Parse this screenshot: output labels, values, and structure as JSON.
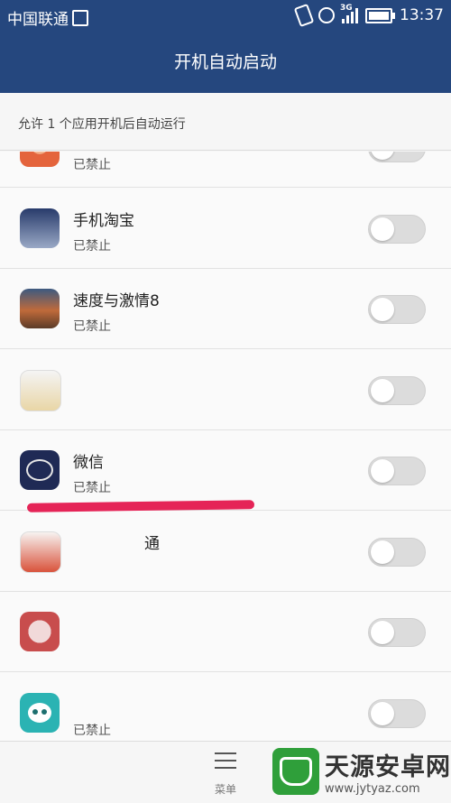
{
  "status_bar": {
    "carrier": "中国联通",
    "network": "3G",
    "time": "13:37"
  },
  "header": {
    "title": "开机自动启动"
  },
  "summary": "允许 1 个应用开机后自动运行",
  "apps": [
    {
      "name": "",
      "status": "已禁止",
      "enabled": false,
      "icon": "orange-app-icon"
    },
    {
      "name": "手机淘宝",
      "status": "已禁止",
      "enabled": false,
      "icon": "taobao-icon"
    },
    {
      "name": "速度与激情8",
      "status": "已禁止",
      "enabled": false,
      "icon": "racing-game-icon"
    },
    {
      "name": "",
      "status": "",
      "enabled": false,
      "icon": "feather-app-icon"
    },
    {
      "name": "微信",
      "status": "已禁止",
      "enabled": false,
      "icon": "wechat-icon"
    },
    {
      "name": "通",
      "status": "",
      "enabled": false,
      "icon": "red-app-icon"
    },
    {
      "name": "",
      "status": "",
      "enabled": false,
      "icon": "pink-app-icon"
    },
    {
      "name": "",
      "status": "已禁止",
      "enabled": false,
      "icon": "teal-app-icon"
    }
  ],
  "bottom_bar": {
    "menu_label": "菜单"
  },
  "watermark": {
    "title": "天源安卓网",
    "url": "www.jytyaz.com"
  }
}
